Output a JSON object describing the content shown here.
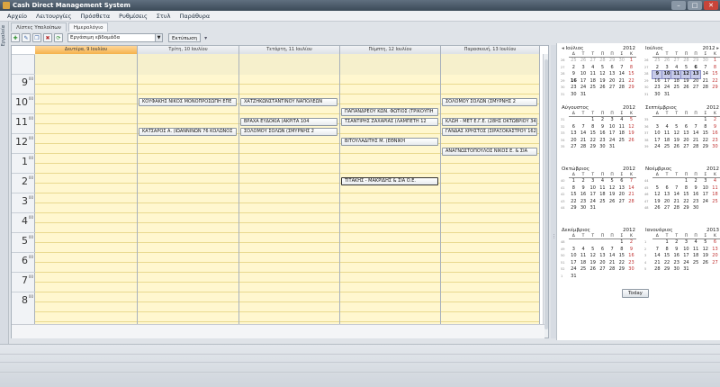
{
  "window": {
    "title": "Cash Direct Management System",
    "controls": [
      "–",
      "□",
      "✕"
    ]
  },
  "menu": [
    "Αρχείο",
    "Λειτουργίες",
    "Πρόσθετα",
    "Ρυθμίσεις",
    "Στυλ",
    "Παράθυρα"
  ],
  "side_label": "Εργαλεία",
  "tabs": [
    {
      "label": "Λίστες Υπολοίπων",
      "active": false
    },
    {
      "label": "Ημερολόγιο",
      "active": true
    }
  ],
  "toolbar": {
    "view_select": "Εργάσιμη εβδομάδα",
    "print_label": "Εκτύπωση"
  },
  "day_headers": [
    {
      "label": "Δευτέρα, 9 Ιουλίου",
      "today": true
    },
    {
      "label": "Τρίτη, 10 Ιουλίου",
      "today": false
    },
    {
      "label": "Τετάρτη, 11 Ιουλίου",
      "today": false
    },
    {
      "label": "Πέμπτη, 12 Ιουλίου",
      "today": false
    },
    {
      "label": "Παρασκευή, 13 Ιουλίου",
      "today": false
    }
  ],
  "hours": [
    "9",
    "10",
    "11",
    "12",
    "1",
    "2",
    "3",
    "4",
    "5",
    "6",
    "7",
    "8"
  ],
  "hour_minutes": "00",
  "events": [
    {
      "day": 1,
      "time": "10:00",
      "label": "ΚΟΥΦΑΚΗΣ ΝΙΚΟΣ ΜΟΝΟΠΡΟΣΩΠΗ ΕΠΕ"
    },
    {
      "day": 1,
      "time": "11:30",
      "label": "ΚΑΤΣΑΡΟΣ Α.  (ΙΩΑΝΝΙΝΩΝ 76 ΚΟΛΩΝΟΣ"
    },
    {
      "day": 2,
      "time": "10:00",
      "label": "ΧΑΤΖΗΚΩΝΣΤΑΝΤΙΝΟΥ ΝΑΠΟΛΕΩΝ"
    },
    {
      "day": 2,
      "time": "11:00",
      "label": "ΒΡΑΧΑ ΕΥΔΟΚΙΑ  (ΑΚΡΙΤΑ 104"
    },
    {
      "day": 2,
      "time": "11:30",
      "label": "ΣΟΛΟΜΟΥ ΣΟΛΩΝ  (ΣΜΥΡΝΗΣ 2"
    },
    {
      "day": 3,
      "time": "10:30",
      "label": "ΠΑΠΑΝΔΡΕΟΥ ΚΩΝ. ΦΩΤΙΟΣ  (ΤΡΙΚΟΥΠΗ"
    },
    {
      "day": 3,
      "time": "11:00",
      "label": "ΤΣΑΝΤΙΡΗΣ ΖΑΧΑΡΙΑΣ  (ΛΑΜΠΕΤΗ 12"
    },
    {
      "day": 3,
      "time": "12:00",
      "label": "ΒΙΤΟΥΛΑΔΙΤΗΣ Μ.  (ΕΘΝΙΚΗ"
    },
    {
      "day": 3,
      "time": "14:00",
      "label": "ΤΙΤΑΚΗΣ - ΜΑΚΡΙΔΗΣ & ΣΙΑ Ο.Ε.",
      "selected": true
    },
    {
      "day": 4,
      "time": "10:00",
      "label": "ΣΟΛΟΜΟΥ ΣΟΛΩΝ  (ΣΜΥΡΝΗΣ 2"
    },
    {
      "day": 4,
      "time": "11:00",
      "label": "ΚΛΩΗ - ΜΕΤ Ε.Γ.Ε.  (28ΗΣ ΟΚΤΩΒΡΙΟΥ 34"
    },
    {
      "day": 4,
      "time": "11:30",
      "label": "ΓΑΝΔΑΣ ΧΡΗΣΤΟΣ  (ΣΙΡΑΞΟΚΑΣΤΡΟΥ 162"
    },
    {
      "day": 4,
      "time": "12:30",
      "label": "ΑΝΑΓΝΩΣΤΟΠΟΥΛΟΣ ΝΙΚΟΣ Ε. & ΣΙΑ"
    }
  ],
  "weekday_letters": [
    "Δ",
    "Τ",
    "Τ",
    "Π",
    "Π",
    "Σ",
    "Κ"
  ],
  "mini_calendars": [
    {
      "month": "Ιούλιος",
      "year": "2012",
      "weeks": [
        [
          "25",
          "26",
          "27",
          "28",
          "29",
          "30",
          "1"
        ],
        [
          "2",
          "3",
          "4",
          "5",
          "6",
          "7",
          "8"
        ],
        [
          "9",
          "10",
          "11",
          "12",
          "13",
          "14",
          "15"
        ],
        [
          "16",
          "17",
          "18",
          "19",
          "20",
          "21",
          "22"
        ],
        [
          "23",
          "24",
          "25",
          "26",
          "27",
          "28",
          "29"
        ],
        [
          "30",
          "31",
          "",
          "",
          "",
          "",
          ""
        ]
      ]
    },
    {
      "month": "Ιούλιος",
      "year": "2012",
      "weeks": [
        [
          "25",
          "26",
          "27",
          "28",
          "29",
          "30",
          "1"
        ],
        [
          "2",
          "3",
          "4",
          "5",
          "6",
          "7",
          "8"
        ],
        [
          "9",
          "10",
          "11",
          "12",
          "13",
          "14",
          "15"
        ],
        [
          "16",
          "17",
          "18",
          "19",
          "20",
          "21",
          "22"
        ],
        [
          "23",
          "24",
          "25",
          "26",
          "27",
          "28",
          "29"
        ],
        [
          "30",
          "31",
          "",
          "",
          "",
          "",
          ""
        ]
      ]
    },
    {
      "month": "Αύγουστος",
      "year": "2012",
      "weeks": [
        [
          "",
          "",
          "1",
          "2",
          "3",
          "4",
          "5"
        ],
        [
          "6",
          "7",
          "8",
          "9",
          "10",
          "11",
          "12"
        ],
        [
          "13",
          "14",
          "15",
          "16",
          "17",
          "18",
          "19"
        ],
        [
          "20",
          "21",
          "22",
          "23",
          "24",
          "25",
          "26"
        ],
        [
          "27",
          "28",
          "29",
          "30",
          "31",
          "",
          ""
        ]
      ]
    },
    {
      "month": "Σεπτέμβριος",
      "year": "2012",
      "weeks": [
        [
          "",
          "",
          "",
          "",
          "",
          "1",
          "2"
        ],
        [
          "3",
          "4",
          "5",
          "6",
          "7",
          "8",
          "9"
        ],
        [
          "10",
          "11",
          "12",
          "13",
          "14",
          "15",
          "16"
        ],
        [
          "17",
          "18",
          "19",
          "20",
          "21",
          "22",
          "23"
        ],
        [
          "24",
          "25",
          "26",
          "27",
          "28",
          "29",
          "30"
        ]
      ]
    },
    {
      "month": "Οκτώβριος",
      "year": "2012",
      "weeks": [
        [
          "1",
          "2",
          "3",
          "4",
          "5",
          "6",
          "7"
        ],
        [
          "8",
          "9",
          "10",
          "11",
          "12",
          "13",
          "14"
        ],
        [
          "15",
          "16",
          "17",
          "18",
          "19",
          "20",
          "21"
        ],
        [
          "22",
          "23",
          "24",
          "25",
          "26",
          "27",
          "28"
        ],
        [
          "29",
          "30",
          "31",
          "",
          "",
          "",
          ""
        ]
      ]
    },
    {
      "month": "Νοέμβριος",
      "year": "2012",
      "weeks": [
        [
          "",
          "",
          "",
          "1",
          "2",
          "3",
          "4"
        ],
        [
          "5",
          "6",
          "7",
          "8",
          "9",
          "10",
          "11"
        ],
        [
          "12",
          "13",
          "14",
          "15",
          "16",
          "17",
          "18"
        ],
        [
          "19",
          "20",
          "21",
          "22",
          "23",
          "24",
          "25"
        ],
        [
          "26",
          "27",
          "28",
          "29",
          "30",
          "",
          ""
        ]
      ]
    },
    {
      "month": "Δεκέμβριος",
      "year": "2012",
      "weeks": [
        [
          "",
          "",
          "",
          "",
          "",
          "1",
          "2"
        ],
        [
          "3",
          "4",
          "5",
          "6",
          "7",
          "8",
          "9"
        ],
        [
          "10",
          "11",
          "12",
          "13",
          "14",
          "15",
          "16"
        ],
        [
          "17",
          "18",
          "19",
          "20",
          "21",
          "22",
          "23"
        ],
        [
          "24",
          "25",
          "26",
          "27",
          "28",
          "29",
          "30"
        ],
        [
          "31",
          "",
          "",
          "",
          "",
          "",
          ""
        ]
      ]
    },
    {
      "month": "Ιανουάριος",
      "year": "2013",
      "weeks": [
        [
          "",
          "1",
          "2",
          "3",
          "4",
          "5",
          "6"
        ],
        [
          "7",
          "8",
          "9",
          "10",
          "11",
          "12",
          "13"
        ],
        [
          "14",
          "15",
          "16",
          "17",
          "18",
          "19",
          "20"
        ],
        [
          "21",
          "22",
          "23",
          "24",
          "25",
          "26",
          "27"
        ],
        [
          "28",
          "29",
          "30",
          "31",
          "",
          "",
          ""
        ]
      ]
    }
  ],
  "today_button": "Today",
  "colors": {
    "accent": "#f5b24c",
    "workday_bg": "#fff7cf",
    "event_border": "#8f99a4",
    "highlight": "#c7cbe9"
  }
}
